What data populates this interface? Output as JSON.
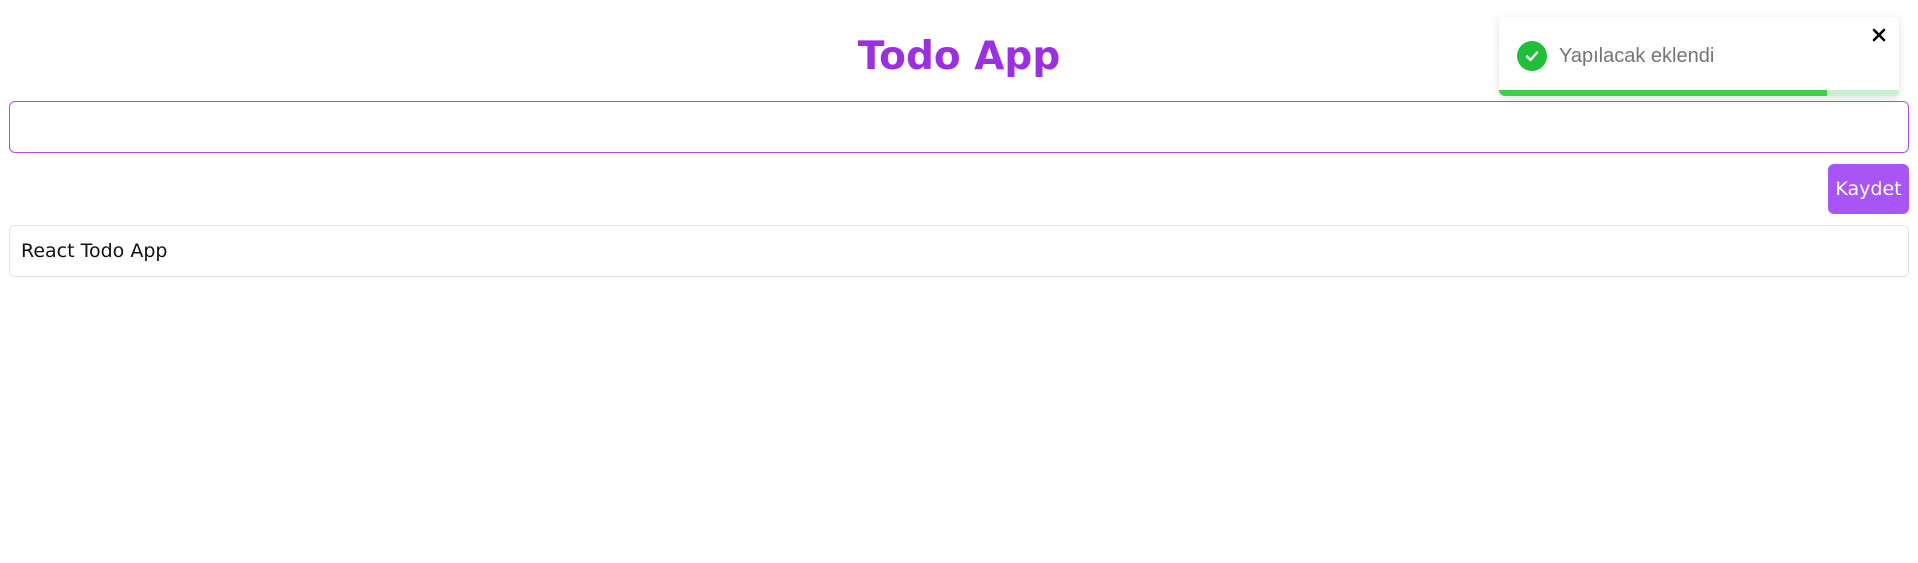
{
  "app": {
    "title": "Todo App"
  },
  "form": {
    "input_value": "",
    "input_placeholder": "",
    "save_label": "Kaydet"
  },
  "todos": [
    {
      "text": "React Todo App"
    }
  ],
  "toast": {
    "message": "Yapılacak eklendi",
    "icon": "check-circle-icon",
    "close_icon": "close-icon",
    "progress": 0.82
  },
  "colors": {
    "title": "#9b30e0",
    "accent": "#a855f7",
    "input_border": "#b24de8",
    "success": "#1fbf3a",
    "progress_fill": "#3fce4a",
    "progress_track": "#c8f2cd"
  }
}
